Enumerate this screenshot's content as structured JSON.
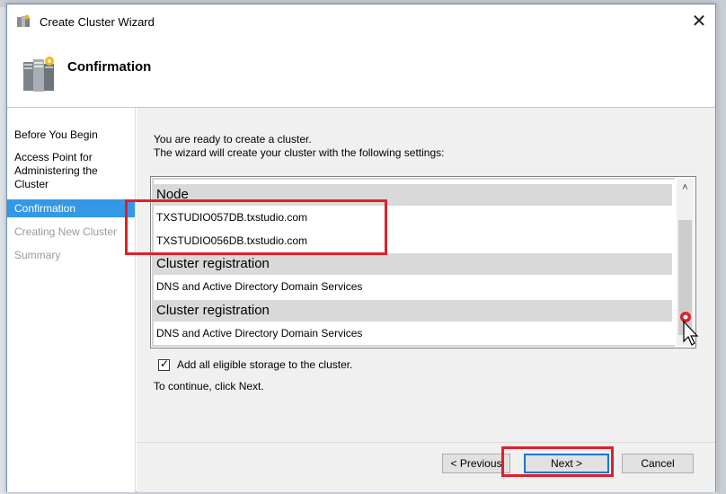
{
  "window": {
    "title": "Create Cluster Wizard",
    "close_glyph": "✕"
  },
  "header": {
    "title": "Confirmation"
  },
  "nav": {
    "items": [
      {
        "label": "Before You Begin",
        "state": "normal"
      },
      {
        "label": "Access Point for Administering the Cluster",
        "state": "normal"
      },
      {
        "label": "Confirmation",
        "state": "active"
      },
      {
        "label": "Creating New Cluster",
        "state": "disabled"
      },
      {
        "label": "Summary",
        "state": "disabled"
      }
    ]
  },
  "content": {
    "intro_line1": "You are ready to create a cluster.",
    "intro_line2": "The wizard will create your cluster with the following settings:",
    "settings": {
      "group1_header": "Node",
      "node1": "TXSTUDIO057DB.txstudio.com",
      "node2": "TXSTUDIO056DB.txstudio.com",
      "group2_header": "Cluster registration",
      "group2_value": "DNS and Active Directory Domain Services",
      "group3_header": "Cluster registration",
      "group3_value": "DNS and Active Directory Domain Services"
    },
    "scroll_up_glyph": "˄",
    "checkbox": {
      "label": "Add all eligible storage to the cluster.",
      "checked": true,
      "mark": "✓"
    },
    "continue_text": "To continue, click Next."
  },
  "buttons": {
    "previous": "< Previous",
    "next": "Next >",
    "cancel": "Cancel"
  },
  "colors": {
    "nav_active": "#3398e6",
    "highlight": "#e0202a",
    "accent": "#0078d7"
  }
}
